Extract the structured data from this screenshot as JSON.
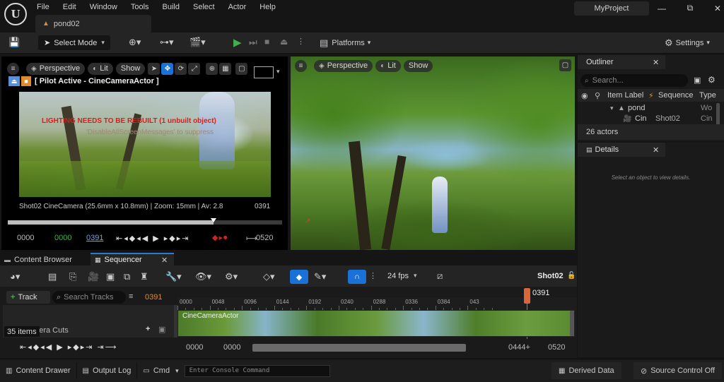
{
  "app": {
    "logo": "U",
    "menu": [
      "File",
      "Edit",
      "Window",
      "Tools",
      "Build",
      "Select",
      "Actor",
      "Help"
    ],
    "project_name": "MyProject",
    "document_tab": "pond02",
    "window_controls": {
      "minimize": "—",
      "maximize": "⧉",
      "close": "✕"
    }
  },
  "toolbar": {
    "select_mode": "Select Mode",
    "platforms": "Platforms",
    "settings": "Settings"
  },
  "left_viewport": {
    "perspective": "Perspective",
    "lit": "Lit",
    "show": "Show",
    "pilot_label": "[ Pilot Active - CineCameraActor ]",
    "warning": "LIGHTING NEEDS TO BE REBUILT (1 unbuilt object)",
    "warning_sub": "'DisableAllScreenMessages' to suppress",
    "camera_info": "Shot02  CineCamera (25.6mm x 10.8mm) | Zoom: 15mm | Av: 2.8",
    "frame_right": "0391",
    "transport": {
      "start": "0000",
      "in": "0000",
      "current": "0391",
      "end": "0520"
    },
    "scrub_fraction": 0.75
  },
  "right_viewport": {
    "perspective": "Perspective",
    "lit": "Lit",
    "show": "Show"
  },
  "outliner": {
    "title": "Outliner",
    "search_placeholder": "Search...",
    "col_label": "Item Label",
    "col_sequence": "Sequence",
    "col_type": "Type",
    "rows": [
      {
        "label": "pond",
        "sequence": "",
        "type": "Wo"
      },
      {
        "label": "Cin",
        "sequence": "Shot02",
        "type": "Cin"
      }
    ],
    "actor_count": "26 actors"
  },
  "details": {
    "title": "Details",
    "empty_message": "Select an object to view details."
  },
  "bottom_tabs": {
    "content_browser": "Content Browser",
    "sequencer": "Sequencer"
  },
  "sequencer": {
    "fps": "24 fps",
    "shot": "Shot02",
    "track_button": "Track",
    "search_placeholder": "Search Tracks",
    "current_frame": "0391",
    "ruler": [
      "0000",
      "0048",
      "0096",
      "0144",
      "0192",
      "0240",
      "0288",
      "0336",
      "0384",
      "043"
    ],
    "playhead": "0391",
    "track_name": "Camera Cuts",
    "clip_label": "CineCameraActor",
    "items_count": "35 items",
    "range": {
      "start1": "0000",
      "start2": "0000",
      "out": "0444+",
      "end": "0520"
    }
  },
  "statusbar": {
    "content_drawer": "Content Drawer",
    "output_log": "Output Log",
    "cmd": "Cmd",
    "console_placeholder": "Enter Console Command",
    "derived_data": "Derived Data",
    "source_control": "Source Control Off"
  },
  "colors": {
    "accent_blue": "#1a72d9",
    "play_green": "#3fb14a",
    "playhead_orange": "#d9653a",
    "frame_orange": "#e08a30",
    "warning_red": "#d0221e"
  }
}
